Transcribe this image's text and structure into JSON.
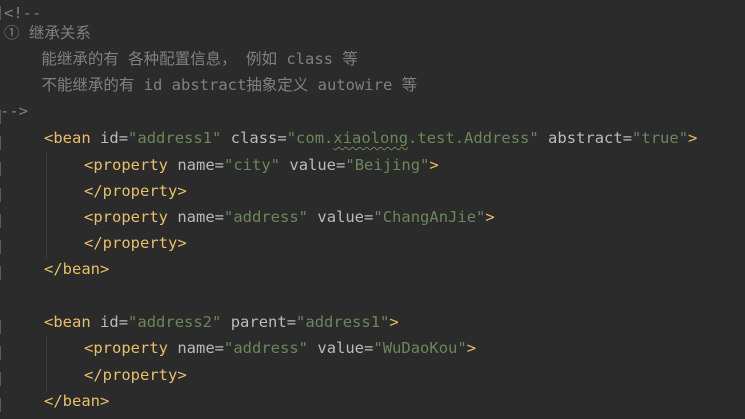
{
  "editor": {
    "lines": [
      {
        "id": "c1",
        "text": "<!--"
      },
      {
        "id": "c2",
        "text": "① 继承关系"
      },
      {
        "id": "c3",
        "text": "    能继承的有 各种配置信息， 例如 class 等"
      },
      {
        "id": "c4",
        "text": "    不能继承的有 id abstract抽象定义 autowire 等"
      },
      {
        "id": "c5",
        "text": "-->"
      }
    ],
    "bean1": {
      "open_tag": "bean",
      "id_attr": "id",
      "id_val": "\"address1\"",
      "class_attr": "class",
      "class_val_prefix": "\"com.",
      "class_val_typo": "xiaolong",
      "class_val_suffix": ".test.Address\"",
      "abstract_attr": "abstract",
      "abstract_val": "\"true\"",
      "prop1_name_attr": "name",
      "prop1_name_val": "\"city\"",
      "prop1_value_attr": "value",
      "prop1_value_val": "\"Beijing\"",
      "prop2_name_attr": "name",
      "prop2_name_val": "\"address\"",
      "prop2_value_attr": "value",
      "prop2_value_val": "\"ChangAnJie\""
    },
    "bean2": {
      "open_tag": "bean",
      "id_attr": "id",
      "id_val": "\"address2\"",
      "parent_attr": "parent",
      "parent_val": "\"address1\"",
      "prop_name_attr": "name",
      "prop_name_val": "\"address\"",
      "prop_value_attr": "value",
      "prop_value_val": "\"WuDaoKou\""
    },
    "tags": {
      "property": "property",
      "bean": "bean"
    },
    "colors": {
      "background": "#2b2b2b",
      "comment": "#808080",
      "tag": "#e8bf6a",
      "attribute": "#bababa",
      "string": "#6a8759"
    }
  }
}
